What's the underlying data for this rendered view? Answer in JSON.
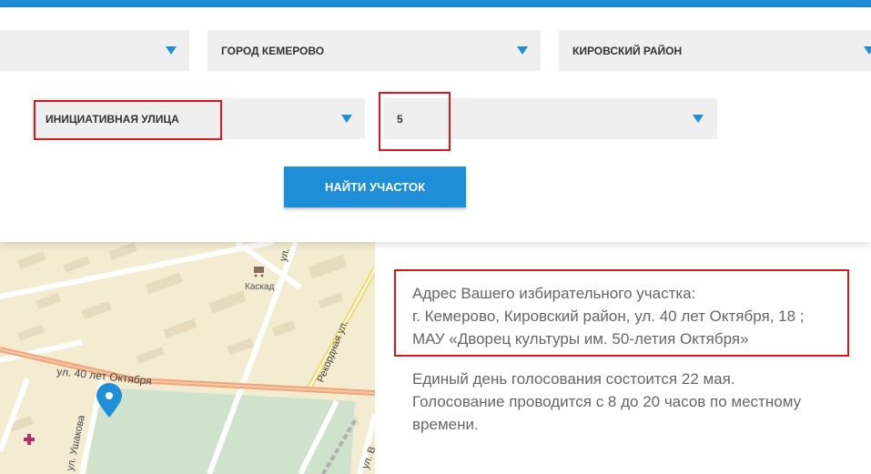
{
  "form": {
    "region_select": {
      "value": ""
    },
    "city_select": {
      "value": "ГОРОД КЕМЕРОВО"
    },
    "district_select": {
      "value": "КИРОВСКИЙ РАЙОН"
    },
    "street_select": {
      "value": "ИНИЦИАТИВНАЯ УЛИЦА"
    },
    "house_select": {
      "value": "5"
    },
    "find_button_label": "НАЙТИ УЧАСТОК"
  },
  "map": {
    "labels": {
      "street_oktyabrya": "ул. 40 лет Октября",
      "street_rekordnaya": "Рекордная ул.",
      "street_ushakova": "ул. Ушакова",
      "shop": "Каскад",
      "street_top": "ул.",
      "street_bottom": "ул. В"
    }
  },
  "result": {
    "address_line1": "Адрес Вашего избирательного участка:",
    "address_line2": "г. Кемерово, Кировский район, ул. 40 лет Октября, 18 ;",
    "address_line3": "МАУ «Дворец культуры им. 50-летия Октября»",
    "voting_line1": "Единый день голосования состоится 22 мая.",
    "voting_line2": "Голосование проводится с 8 до 20 часов по местному",
    "voting_line3": "времени."
  },
  "colors": {
    "accent": "#1e8ed6",
    "highlight": "#d7191f",
    "select_bg": "#efefef",
    "map_bg": "#f3ecd1"
  }
}
